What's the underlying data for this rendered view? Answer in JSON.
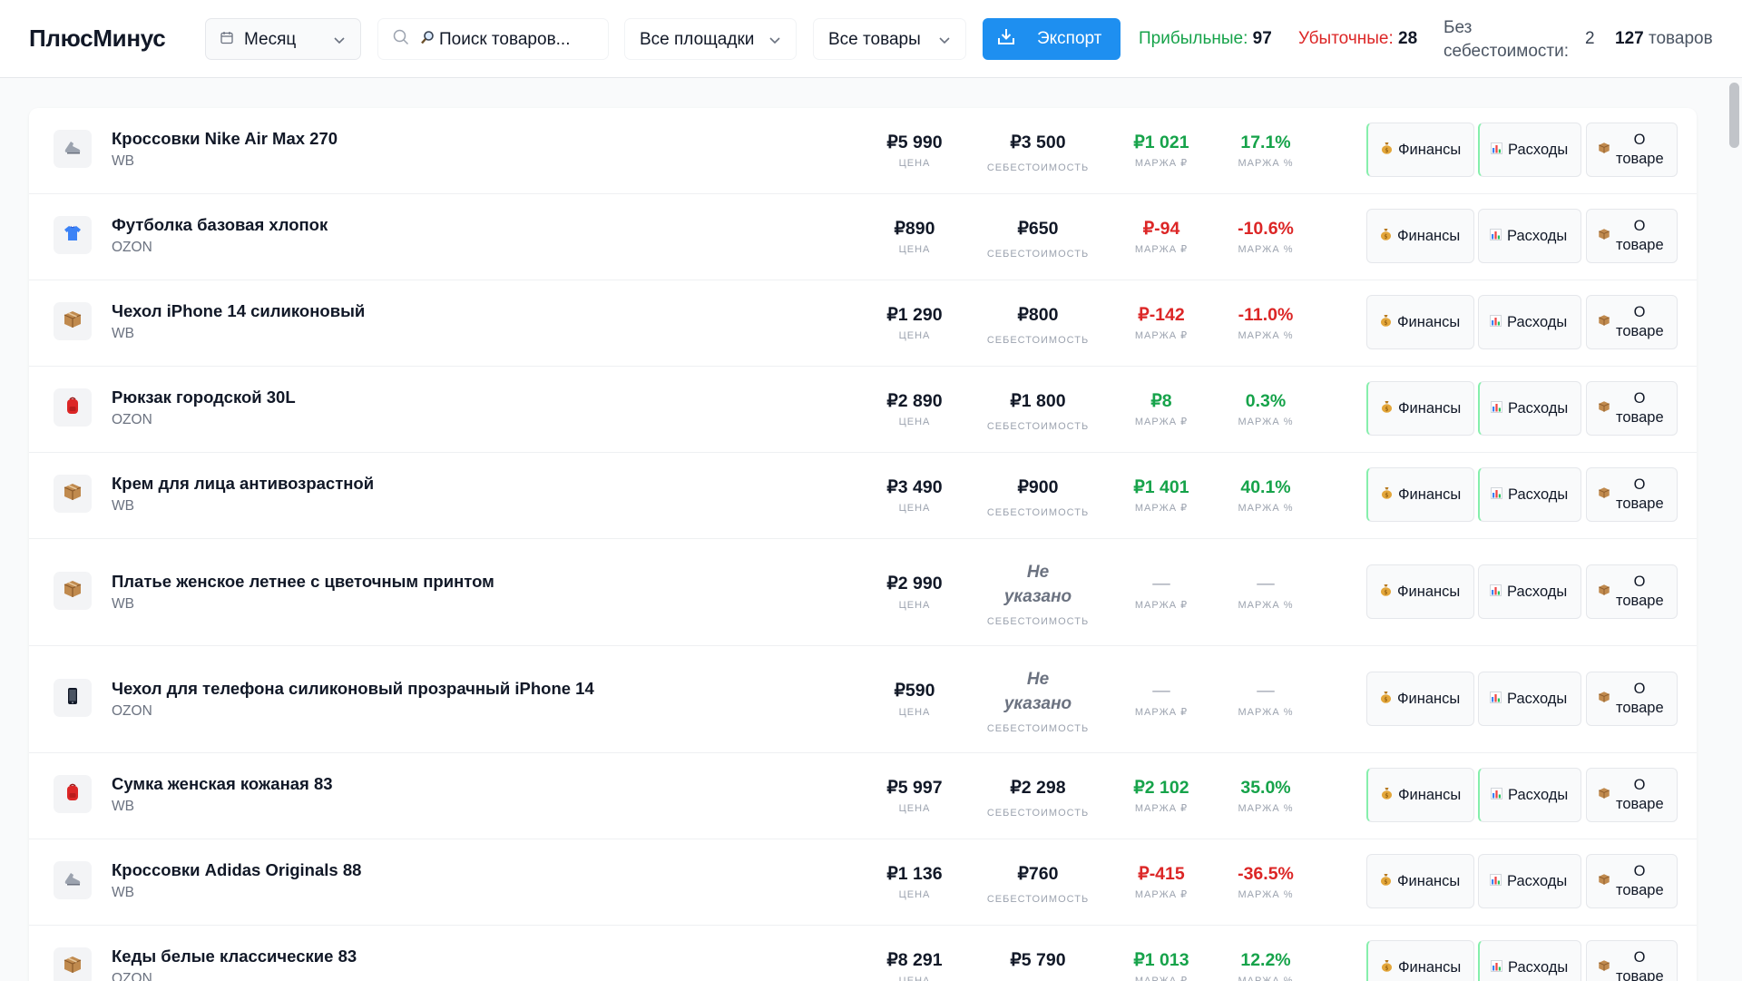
{
  "header": {
    "logo": "ПлюсМинус",
    "period": "Месяц",
    "search_placeholder": "Поиск товаров...",
    "platforms": "Все площадки",
    "products_filter": "Все товары",
    "export": "Экспорт",
    "stats": {
      "profitable_label": "Прибыльные:",
      "profitable_value": "97",
      "loss_label": "Убыточные:",
      "loss_value": "28",
      "no_cost_label": "Без себестоимости:",
      "no_cost_value": "2",
      "total_value": "127",
      "total_label": "товаров"
    }
  },
  "colors": {
    "accent": "#1e8ff0",
    "positive": "#16a34a",
    "negative": "#dc2626"
  },
  "labels": {
    "price": "ЦЕНА",
    "cost": "СЕБЕСТОИМОСТЬ",
    "margin_rub": "МАРЖА ₽",
    "margin_pct": "МАРЖА %"
  },
  "buttons": {
    "finance": "Финансы",
    "expenses": "Расходы",
    "about": "О товаре"
  },
  "products": [
    {
      "name": "Кроссовки Nike Air Max 270",
      "platform": "WB",
      "price": "₽5 990",
      "cost": "₽3 500",
      "margin_rub": "₽1 021",
      "margin_pct": "17.1%",
      "status": "positive",
      "icon": "sneaker-icon"
    },
    {
      "name": "Футболка базовая хлопок",
      "platform": "OZON",
      "price": "₽890",
      "cost": "₽650",
      "margin_rub": "₽-94",
      "margin_pct": "-10.6%",
      "status": "negative",
      "icon": "tshirt-icon"
    },
    {
      "name": "Чехол iPhone 14 силиконовый",
      "platform": "WB",
      "price": "₽1 290",
      "cost": "₽800",
      "margin_rub": "₽-142",
      "margin_pct": "-11.0%",
      "status": "negative",
      "icon": "package-icon"
    },
    {
      "name": "Рюкзак городской 30L",
      "platform": "OZON",
      "price": "₽2 890",
      "cost": "₽1 800",
      "margin_rub": "₽8",
      "margin_pct": "0.3%",
      "status": "positive",
      "icon": "backpack-icon"
    },
    {
      "name": "Крем для лица антивозрастной",
      "platform": "WB",
      "price": "₽3 490",
      "cost": "₽900",
      "margin_rub": "₽1 401",
      "margin_pct": "40.1%",
      "status": "positive",
      "icon": "package-icon"
    },
    {
      "name": "Платье женское летнее с цветочным принтом",
      "platform": "WB",
      "price": "₽2 990",
      "cost": "Не указано",
      "margin_rub": "—",
      "margin_pct": "—",
      "status": "none",
      "icon": "package-icon"
    },
    {
      "name": "Чехол для телефона силиконовый прозрачный iPhone 14",
      "platform": "OZON",
      "price": "₽590",
      "cost": "Не указано",
      "margin_rub": "—",
      "margin_pct": "—",
      "status": "none",
      "icon": "phone-icon"
    },
    {
      "name": "Сумка женская кожаная 83",
      "platform": "WB",
      "price": "₽5 997",
      "cost": "₽2 298",
      "margin_rub": "₽2 102",
      "margin_pct": "35.0%",
      "status": "positive",
      "icon": "backpack-icon"
    },
    {
      "name": "Кроссовки Adidas Originals 88",
      "platform": "WB",
      "price": "₽1 136",
      "cost": "₽760",
      "margin_rub": "₽-415",
      "margin_pct": "-36.5%",
      "status": "negative",
      "icon": "sneaker-icon"
    },
    {
      "name": "Кеды белые классические 83",
      "platform": "OZON",
      "price": "₽8 291",
      "cost": "₽5 790",
      "margin_rub": "₽1 013",
      "margin_pct": "12.2%",
      "status": "positive",
      "icon": "package-icon"
    }
  ]
}
